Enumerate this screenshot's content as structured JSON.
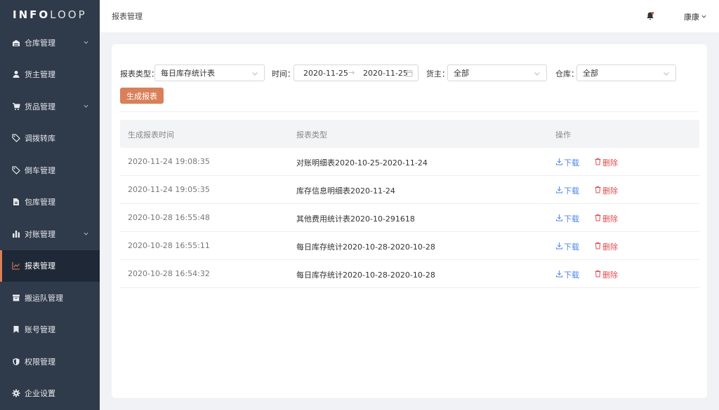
{
  "app": {
    "logo_bold": "INFO",
    "logo_light": "LOOP"
  },
  "sidebar": {
    "items": [
      {
        "label": "仓库管理",
        "icon": "warehouse-icon",
        "has_submenu": true
      },
      {
        "label": "货主管理",
        "icon": "user-icon",
        "has_submenu": false
      },
      {
        "label": "货品管理",
        "icon": "cart-icon",
        "has_submenu": true
      },
      {
        "label": "调拨转库",
        "icon": "tag-icon",
        "has_submenu": false
      },
      {
        "label": "倒车管理",
        "icon": "tag-icon",
        "has_submenu": false
      },
      {
        "label": "包库管理",
        "icon": "file-icon",
        "has_submenu": false
      },
      {
        "label": "对账管理",
        "icon": "bar-chart-icon",
        "has_submenu": true
      },
      {
        "label": "报表管理",
        "icon": "line-chart-icon",
        "has_submenu": false,
        "active": true
      },
      {
        "label": "搬运队管理",
        "icon": "box-icon",
        "has_submenu": false
      },
      {
        "label": "账号管理",
        "icon": "bookmark-icon",
        "has_submenu": false
      },
      {
        "label": "权限管理",
        "icon": "shield-icon",
        "has_submenu": false
      },
      {
        "label": "企业设置",
        "icon": "gear-icon",
        "has_submenu": false
      }
    ]
  },
  "header": {
    "breadcrumb": "报表管理",
    "user": "康康"
  },
  "filters": {
    "report_type_label": "报表类型：",
    "report_type_value": "每日库存统计表",
    "time_label": "时间：",
    "date_start": "2020-11-25",
    "date_sep": "→",
    "date_end": "2020-11-25",
    "owner_label": "货主：",
    "owner_value": "全部",
    "warehouse_label": "仓库：",
    "warehouse_value": "全部"
  },
  "generate_button": "生成报表",
  "table": {
    "headers": [
      "生成报表时间",
      "报表类型",
      "操作"
    ],
    "download_label": "下载",
    "delete_label": "删除",
    "rows": [
      {
        "time": "2020-11-24 19:08:35",
        "type": "对账明细表2020-10-25-2020-11-24"
      },
      {
        "time": "2020-11-24 19:05:35",
        "type": "库存信息明细表2020-11-24"
      },
      {
        "time": "2020-10-28 16:55:48",
        "type": "其他费用统计表2020-10-291618"
      },
      {
        "time": "2020-10-28 16:55:11",
        "type": "每日库存统计2020-10-28-2020-10-28"
      },
      {
        "time": "2020-10-28 16:54:32",
        "type": "每日库存统计2020-10-28-2020-10-28"
      }
    ]
  },
  "colors": {
    "sidebar_bg": "#2f3a4a",
    "accent": "#d9805a",
    "link": "#4a86e8",
    "danger": "#e04d4d"
  }
}
